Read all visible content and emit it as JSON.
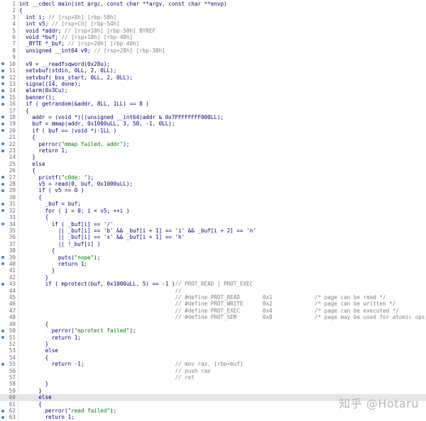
{
  "lines": [
    {
      "n": "1",
      "bp": false,
      "t": "int __cdecl main(int argc, const char **argv, const char **envp)"
    },
    {
      "n": "2",
      "bp": false,
      "t": "{"
    },
    {
      "n": "3",
      "bp": false,
      "t": "  int i; // [rsp+8h] [rbp-58h]"
    },
    {
      "n": "4",
      "bp": false,
      "t": "  int v5; // [rsp+Ch] [rbp-54h]"
    },
    {
      "n": "5",
      "bp": false,
      "t": "  void *addr; // [rsp+10h] [rbp-50h] BYREF"
    },
    {
      "n": "6",
      "bp": false,
      "t": "  void *buf; // [rsp+18h] [rbp-48h]"
    },
    {
      "n": "7",
      "bp": false,
      "t": "  _BYTE *_buf; // [rsp+20h] [rbp-40h]"
    },
    {
      "n": "8",
      "bp": false,
      "t": "  unsigned __int64 v9; // [rsp+28h] [rbp-38h]"
    },
    {
      "n": "9",
      "bp": false,
      "t": ""
    },
    {
      "n": "10",
      "bp": true,
      "t": "  v9 = __readfsqword(0x28u);"
    },
    {
      "n": "11",
      "bp": true,
      "t": "  setvbuf(stdin, 0LL, 2, 0LL);"
    },
    {
      "n": "12",
      "bp": true,
      "t": "  setvbuf(_bss_start, 0LL, 2, 0LL);"
    },
    {
      "n": "13",
      "bp": true,
      "t": "  signal(14, done);"
    },
    {
      "n": "14",
      "bp": true,
      "t": "  alarm(0x3Cu);"
    },
    {
      "n": "15",
      "bp": true,
      "t": "  banner();"
    },
    {
      "n": "16",
      "bp": true,
      "t": "  if ( getrandom(&addr, 8LL, 1LL) == 8 )"
    },
    {
      "n": "17",
      "bp": false,
      "t": "  {"
    },
    {
      "n": "18",
      "bp": true,
      "t": "    addr = (void *)((unsigned __int64)addr & 0x7FFFFFFFF000LL);"
    },
    {
      "n": "19",
      "bp": true,
      "t": "    buf = mmap(addr, 0x1000uLL, 3, 50, -1, 0LL);"
    },
    {
      "n": "20",
      "bp": true,
      "t": "    if ( buf == (void *)-1LL )"
    },
    {
      "n": "21",
      "bp": false,
      "t": "    {"
    },
    {
      "n": "22",
      "bp": true,
      "t": "      perror(\"mmap failed, addr\");"
    },
    {
      "n": "23",
      "bp": true,
      "t": "      return 1;"
    },
    {
      "n": "24",
      "bp": false,
      "t": "    }"
    },
    {
      "n": "25",
      "bp": false,
      "t": "    else"
    },
    {
      "n": "26",
      "bp": false,
      "t": "    {"
    },
    {
      "n": "27",
      "bp": true,
      "t": "      printf(\"c0de: \");"
    },
    {
      "n": "28",
      "bp": true,
      "t": "      v5 = read(0, buf, 0x1000uLL);"
    },
    {
      "n": "29",
      "bp": true,
      "t": "      if ( v5 >= 0 )"
    },
    {
      "n": "30",
      "bp": false,
      "t": "      {"
    },
    {
      "n": "31",
      "bp": true,
      "t": "        _buf = buf;"
    },
    {
      "n": "32",
      "bp": true,
      "t": "        for ( i = 0; i < v5; ++i )"
    },
    {
      "n": "33",
      "bp": false,
      "t": "        {"
    },
    {
      "n": "34",
      "bp": true,
      "t": "          if ( _buf[i] == '/'"
    },
    {
      "n": "35",
      "bp": false,
      "t": "            || _buf[i] == 'b' && _buf[i + 1] == 'i' && _buf[i + 2] == 'n'"
    },
    {
      "n": "36",
      "bp": false,
      "t": "            || _buf[i] == 's' && _buf[i + 1] == 'h'"
    },
    {
      "n": "37",
      "bp": false,
      "t": "            || !_buf[i] )"
    },
    {
      "n": "38",
      "bp": false,
      "t": "          {"
    },
    {
      "n": "39",
      "bp": true,
      "t": "            puts(\"nope\");"
    },
    {
      "n": "40",
      "bp": true,
      "t": "            return 1;"
    },
    {
      "n": "41",
      "bp": false,
      "t": "          }"
    },
    {
      "n": "42",
      "bp": false,
      "t": "        }"
    },
    {
      "n": "43",
      "bp": true,
      "t": "        if ( mprotect(buf, 0x1000uLL, 5) == -1 )// PROT_READ | PROT_EXEC"
    },
    {
      "n": "44",
      "bp": false,
      "t": "                                                //"
    },
    {
      "n": "45",
      "bp": false,
      "t": "                                                // #define PROT_READ       0x1             /* page can be read */"
    },
    {
      "n": "46",
      "bp": false,
      "t": "                                                // #define PROT_WRITE      0x2             /* page can be written */"
    },
    {
      "n": "47",
      "bp": false,
      "t": "                                                // #define PROT_EXEC       0x4             /* page can be executed */"
    },
    {
      "n": "48",
      "bp": false,
      "t": "                                                // #define PROT_SEM        0x8             /* page may be used for atomic ops */"
    },
    {
      "n": "49",
      "bp": false,
      "t": "        {"
    },
    {
      "n": "50",
      "bp": true,
      "t": "          perror(\"mprotect failed\");"
    },
    {
      "n": "51",
      "bp": true,
      "t": "          return 1;"
    },
    {
      "n": "52",
      "bp": false,
      "t": "        }"
    },
    {
      "n": "53",
      "bp": false,
      "t": "        else"
    },
    {
      "n": "54",
      "bp": false,
      "t": "        {"
    },
    {
      "n": "55",
      "bp": true,
      "t": "          return -1;                            // mov rax, [rbp+buf]"
    },
    {
      "n": "56",
      "bp": false,
      "t": "                                                // push rax"
    },
    {
      "n": "57",
      "bp": false,
      "t": "                                                // ret"
    },
    {
      "n": "58",
      "bp": false,
      "t": "        }"
    },
    {
      "n": "59",
      "bp": false,
      "t": "      }"
    },
    {
      "n": "60",
      "bp": false,
      "t": "      else",
      "highlight": true
    },
    {
      "n": "61",
      "bp": false,
      "t": "      {"
    },
    {
      "n": "62",
      "bp": true,
      "t": "        perror(\"read failed\");"
    },
    {
      "n": "63",
      "bp": true,
      "t": "        return 1;"
    }
  ],
  "watermark": "知乎 @Hotaru",
  "colors": {
    "code": "#000080",
    "comment": "#808080",
    "string": "#008000",
    "line_number": "#6e6e6e",
    "breakpoint_dot": "#3d85c6",
    "current_line": "#e6e6e6"
  }
}
